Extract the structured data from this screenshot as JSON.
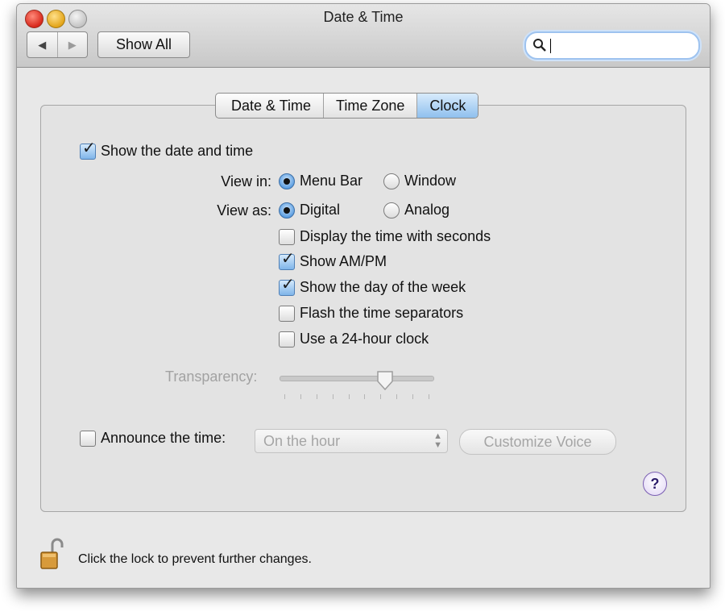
{
  "window": {
    "title": "Date & Time",
    "toolbar": {
      "back_label": "◀",
      "forward_label": "▶",
      "show_all_label": "Show All",
      "search_value": ""
    }
  },
  "tabs": [
    {
      "label": "Date & Time",
      "active": false
    },
    {
      "label": "Time Zone",
      "active": false
    },
    {
      "label": "Clock",
      "active": true
    }
  ],
  "clock": {
    "show_date_time": {
      "label": "Show the date and time",
      "checked": true
    },
    "view_in": {
      "label": "View in:",
      "options": [
        {
          "label": "Menu Bar",
          "selected": true
        },
        {
          "label": "Window",
          "selected": false
        }
      ]
    },
    "view_as": {
      "label": "View as:",
      "options": [
        {
          "label": "Digital",
          "selected": true
        },
        {
          "label": "Analog",
          "selected": false
        }
      ]
    },
    "options": [
      {
        "label": "Display the time with seconds",
        "checked": false
      },
      {
        "label": "Show AM/PM",
        "checked": true
      },
      {
        "label": "Show the day of the week",
        "checked": true
      },
      {
        "label": "Flash the time separators",
        "checked": false
      },
      {
        "label": "Use a 24-hour clock",
        "checked": false
      }
    ],
    "transparency": {
      "label": "Transparency:",
      "value": 0.7
    },
    "announce": {
      "label": "Announce the time:",
      "checked": false,
      "interval": "On the hour",
      "customize_label": "Customize Voice"
    }
  },
  "help_label": "?",
  "lock_text": "Click the lock to prevent further changes.",
  "colors": {
    "accent": "#6fa9e8",
    "window_bg": "#e8e8e8",
    "disabled_text": "#a5a5a5"
  }
}
